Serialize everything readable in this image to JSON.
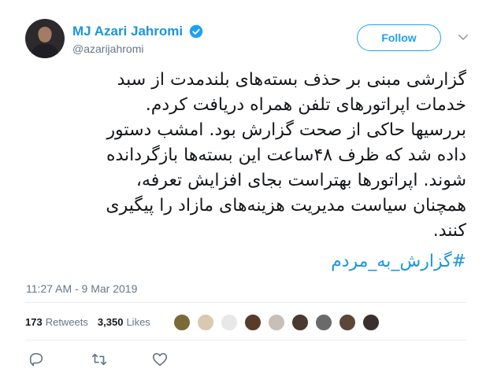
{
  "user": {
    "display_name": "MJ Azari Jahromi",
    "handle": "@azarijahromi",
    "verified": true
  },
  "follow_button": {
    "label": "Follow"
  },
  "tweet": {
    "lines": [
      "گزارشی مبنی بر حذف بسته‌های بلندمدت از سبد",
      "خدمات اپراتورهای تلفن همراه دریافت کردم.",
      "بررسیها حاکی از صحت گزارش بود. امشب دستور",
      "داده شد که ظرف ۴۸ساعت این بسته‌ها بازگردانده",
      "شوند. اپراتورها بهتراست بجای افزایش تعرفه،",
      "همچنان سیاست مدیریت هزینه‌های مازاد را پیگیری",
      "کنند."
    ],
    "hashtag": "#گزارش_به_مردم"
  },
  "timestamp": "11:27 AM - 9 Mar 2019",
  "stats": {
    "retweets_count": "173",
    "retweets_label": "Retweets",
    "likes_count": "3,350",
    "likes_label": "Likes"
  },
  "liker_colors": [
    "#7a6a3a",
    "#d9c9b0",
    "#e8e8e8",
    "#5a3b2a",
    "#c8c0b8",
    "#4a3a30",
    "#6a6a6a",
    "#5b4638",
    "#3a3030"
  ],
  "colors": {
    "accent": "#1da1f2",
    "link": "#1b95e0",
    "secondary_text": "#657786"
  }
}
